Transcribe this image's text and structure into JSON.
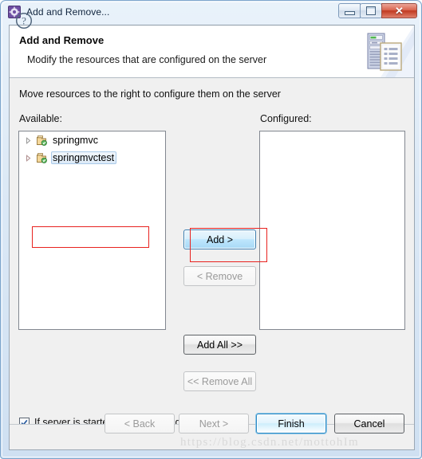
{
  "window": {
    "title": "Add and Remove...",
    "icon": "gear-icon",
    "controls": {
      "minimize": "Minimize",
      "maximize": "Restore",
      "close": "Close",
      "close_glyph": "✕"
    }
  },
  "header": {
    "title": "Add and Remove",
    "description": "Modify the resources that are configured on the server",
    "icon": "server-document-icon"
  },
  "content": {
    "instruction": "Move resources to the right to configure them on the server",
    "available": {
      "label": "Available:",
      "items": [
        {
          "name": "springmvc",
          "icon": "project-icon",
          "selected": false,
          "expandable": true
        },
        {
          "name": "springmvctest",
          "icon": "project-icon",
          "selected": true,
          "expandable": true
        }
      ]
    },
    "configured": {
      "label": "Configured:",
      "items": []
    },
    "transfer_buttons": [
      {
        "id": "add",
        "label": "Add >",
        "state": "focused"
      },
      {
        "id": "remove",
        "label": "< Remove",
        "state": "disabled"
      },
      {
        "id": "add-all",
        "label": "Add All >>",
        "state": "enabled"
      },
      {
        "id": "remove-all",
        "label": "<< Remove All",
        "state": "disabled"
      }
    ],
    "publish_checkbox": {
      "label": "If server is started, publish changes immediately",
      "checked": true
    }
  },
  "footer": {
    "help": "?",
    "buttons": [
      {
        "id": "back",
        "label": "< Back",
        "state": "disabled"
      },
      {
        "id": "next",
        "label": "Next >",
        "state": "disabled"
      },
      {
        "id": "finish",
        "label": "Finish",
        "state": "default"
      },
      {
        "id": "cancel",
        "label": "Cancel",
        "state": "enabled"
      }
    ]
  },
  "watermark": "https://blog.csdn.net/mottohIm",
  "colors": {
    "annotation_red": "#e8221f",
    "title_bar": "#dce9f6",
    "selection_blue": "#bee6fd",
    "default_button_border": "#2c8ac4"
  }
}
